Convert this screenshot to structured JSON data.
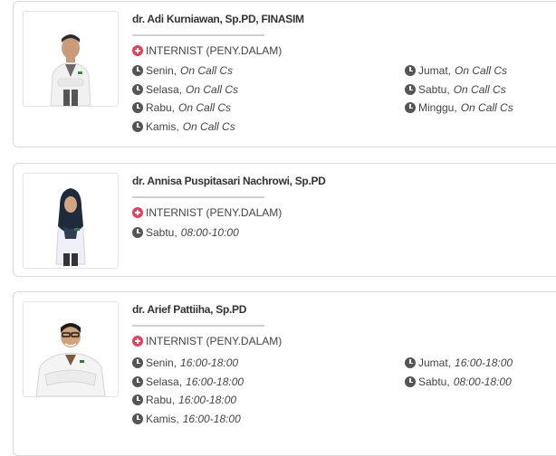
{
  "doctors": [
    {
      "name": "dr. Adi Kurniawan, Sp.PD, FINASIM",
      "specialty": "INTERNIST (PENY.DALAM)",
      "schedule_left": [
        {
          "day": "Senin,",
          "time": "On Call Cs"
        },
        {
          "day": "Selasa,",
          "time": "On Call Cs"
        },
        {
          "day": "Rabu,",
          "time": "On Call Cs"
        },
        {
          "day": "Kamis,",
          "time": "On Call Cs"
        }
      ],
      "schedule_right": [
        {
          "day": "Jumat,",
          "time": "On Call Cs"
        },
        {
          "day": "Sabtu,",
          "time": "On Call Cs"
        },
        {
          "day": "Minggu,",
          "time": "On Call Cs"
        }
      ]
    },
    {
      "name": "dr. Annisa Puspitasari Nachrowi, Sp.PD",
      "specialty": "INTERNIST (PENY.DALAM)",
      "schedule_left": [
        {
          "day": "Sabtu,",
          "time": "08:00-10:00"
        }
      ],
      "schedule_right": []
    },
    {
      "name": "dr. Arief Pattiiha, Sp.PD",
      "specialty": "INTERNIST (PENY.DALAM)",
      "schedule_left": [
        {
          "day": "Senin,",
          "time": "16:00-18:00"
        },
        {
          "day": "Selasa,",
          "time": "16:00-18:00"
        },
        {
          "day": "Rabu,",
          "time": "16:00-18:00"
        },
        {
          "day": "Kamis,",
          "time": "16:00-18:00"
        }
      ],
      "schedule_right": [
        {
          "day": "Jumat,",
          "time": "16:00-18:00"
        },
        {
          "day": "Sabtu,",
          "time": "08:00-18:00"
        }
      ]
    }
  ]
}
